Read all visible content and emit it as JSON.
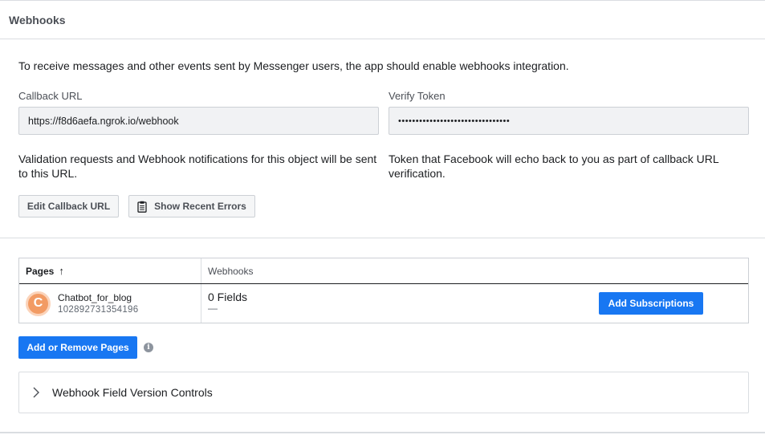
{
  "header": {
    "title": "Webhooks"
  },
  "intro": "To receive messages and other events sent by Messenger users, the app should enable webhooks integration.",
  "callback": {
    "label": "Callback URL",
    "value": "https://f8d6aefa.ngrok.io/webhook",
    "help": "Validation requests and Webhook notifications for this object will be sent to this URL."
  },
  "verify": {
    "label": "Verify Token",
    "value": "••••••••••••••••••••••••••••••••",
    "help": "Token that Facebook will echo back to you as part of callback URL verification."
  },
  "buttons": {
    "edit_callback": "Edit Callback URL",
    "show_errors": "Show Recent Errors",
    "add_subscriptions": "Add Subscriptions",
    "add_remove_pages": "Add or Remove Pages"
  },
  "table": {
    "col_pages": "Pages",
    "sort_arrow": "↑",
    "col_webhooks": "Webhooks",
    "rows": [
      {
        "avatar_letter": "C",
        "name": "Chatbot_for_blog",
        "id": "102892731354196",
        "fields": "0 Fields",
        "fields_detail": "—"
      }
    ]
  },
  "info_glyph": "i",
  "accordion": {
    "label": "Webhook Field Version Controls"
  },
  "icons": {
    "clipboard": "clipboard-icon",
    "info": "info-icon",
    "chevron": "chevron-right-icon"
  },
  "colors": {
    "primary": "#1877f2",
    "avatar": "#f29b64",
    "border": "#dadde1"
  }
}
